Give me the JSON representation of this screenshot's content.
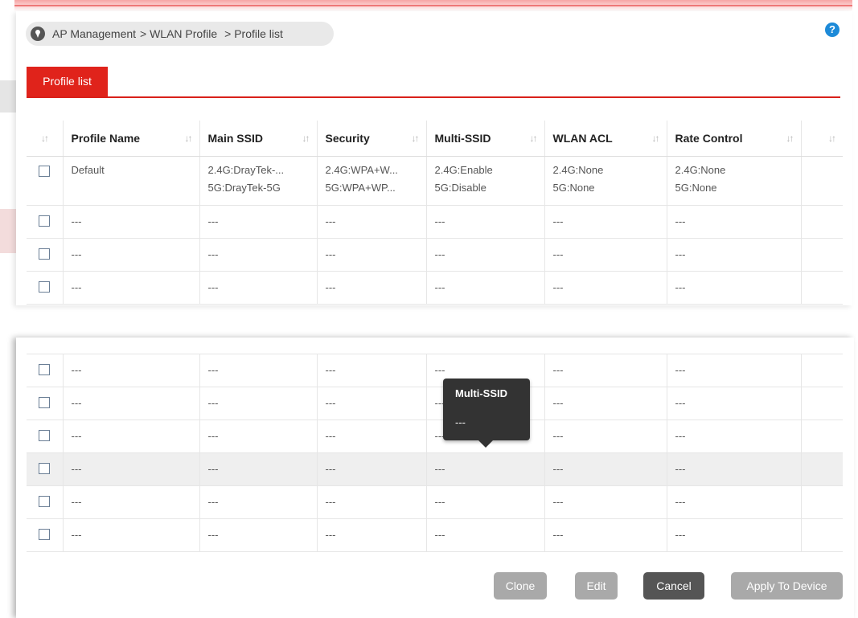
{
  "breadcrumb": {
    "items": [
      "AP Management",
      "> WLAN Profile",
      "> Profile list"
    ]
  },
  "help_icon": "question-circle-icon",
  "tab": {
    "label": "Profile list"
  },
  "table": {
    "columns": [
      "Profile Name",
      "Main SSID",
      "Security",
      "Multi-SSID",
      "WLAN ACL",
      "Rate Control"
    ],
    "rows_top": [
      {
        "profile_name": "Default",
        "main_ssid": [
          "2.4G:DrayTek-...",
          "5G:DrayTek-5G"
        ],
        "security": [
          "2.4G:WPA+W...",
          "5G:WPA+WP..."
        ],
        "multi_ssid": [
          "2.4G:Enable",
          "5G:Disable"
        ],
        "wlan_acl": [
          "2.4G:None",
          "5G:None"
        ],
        "rate_control": [
          "2.4G:None",
          "5G:None"
        ]
      },
      {
        "profile_name": "---",
        "main_ssid": "---",
        "security": "---",
        "multi_ssid": "---",
        "wlan_acl": "---",
        "rate_control": "---"
      },
      {
        "profile_name": "---",
        "main_ssid": "---",
        "security": "---",
        "multi_ssid": "---",
        "wlan_acl": "---",
        "rate_control": "---"
      },
      {
        "profile_name": "---",
        "main_ssid": "---",
        "security": "---",
        "multi_ssid": "---",
        "wlan_acl": "---",
        "rate_control": "---"
      }
    ],
    "rows_bottom": [
      {
        "profile_name": "---",
        "main_ssid": "---",
        "security": "---",
        "multi_ssid": "---",
        "wlan_acl": "---",
        "rate_control": "---"
      },
      {
        "profile_name": "---",
        "main_ssid": "---",
        "security": "---",
        "multi_ssid": "---",
        "wlan_acl": "---",
        "rate_control": "---"
      },
      {
        "profile_name": "---",
        "main_ssid": "---",
        "security": "---",
        "multi_ssid": "---",
        "wlan_acl": "---",
        "rate_control": "---"
      },
      {
        "profile_name": "---",
        "main_ssid": "---",
        "security": "---",
        "multi_ssid": "---",
        "wlan_acl": "---",
        "rate_control": "---"
      },
      {
        "profile_name": "---",
        "main_ssid": "---",
        "security": "---",
        "multi_ssid": "---",
        "wlan_acl": "---",
        "rate_control": "---"
      },
      {
        "profile_name": "---",
        "main_ssid": "---",
        "security": "---",
        "multi_ssid": "---",
        "wlan_acl": "---",
        "rate_control": "---"
      }
    ],
    "highlighted_bottom_row": 3
  },
  "tooltip": {
    "title": "Multi-SSID",
    "value": "---"
  },
  "buttons": {
    "clone": "Clone",
    "edit": "Edit",
    "cancel": "Cancel",
    "apply": "Apply To Device"
  },
  "colors": {
    "accent_red": "#e0231b",
    "help_blue": "#1d8ad8",
    "button_gray": "#a9a9a9",
    "button_dark": "#555555",
    "tooltip_bg": "#333333"
  }
}
